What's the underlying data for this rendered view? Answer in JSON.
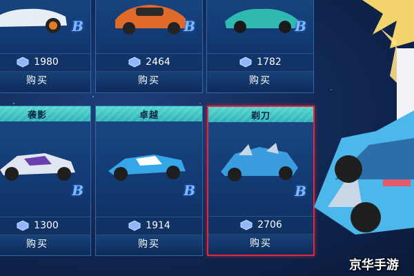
{
  "top_row": [
    {
      "price": "1980",
      "buy": "购买",
      "badge": "B"
    },
    {
      "price": "2464",
      "buy": "购买",
      "badge": "B"
    },
    {
      "price": "1782",
      "buy": "购买",
      "badge": "B"
    }
  ],
  "bottom_row": [
    {
      "name": "袭影",
      "price": "1300",
      "buy": "购买",
      "badge": "B"
    },
    {
      "name": "卓越",
      "price": "1914",
      "buy": "购买",
      "badge": "B"
    },
    {
      "name": "剃刀",
      "price": "2706",
      "buy": "购买",
      "badge": "B",
      "selected": true
    }
  ],
  "watermark": "京华手游",
  "colors": {
    "header": "#3fc4c4",
    "card_bg": "#133a72",
    "selected_border": "#e0293c",
    "badge": "#7fb8ff"
  },
  "icons": {
    "coin": "gem-coupon-icon",
    "grade": "grade-b-icon"
  }
}
